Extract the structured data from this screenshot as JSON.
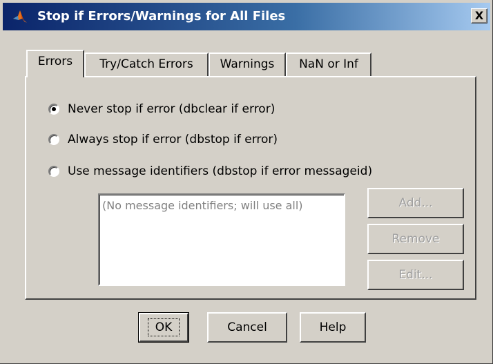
{
  "window": {
    "title": "Stop if Errors/Warnings for All Files",
    "close_label": "X"
  },
  "tabs": [
    {
      "label": "Errors",
      "active": true
    },
    {
      "label": "Try/Catch Errors",
      "active": false
    },
    {
      "label": "Warnings",
      "active": false
    },
    {
      "label": "NaN or Inf",
      "active": false
    }
  ],
  "errors_panel": {
    "options": [
      {
        "label": "Never stop if error (dbclear if error)",
        "selected": true
      },
      {
        "label": "Always stop if error (dbstop if error)",
        "selected": false
      },
      {
        "label": "Use message identifiers (dbstop if error messageid)",
        "selected": false
      }
    ],
    "identifiers_list": {
      "placeholder": "(No message identifiers; will use all)",
      "items": []
    },
    "buttons": {
      "add_label": "Add...",
      "remove_label": "Remove",
      "edit_label": "Edit..."
    }
  },
  "footer": {
    "ok_label": "OK",
    "cancel_label": "Cancel",
    "help_label": "Help"
  },
  "icons": {
    "app": "matlab-logo-icon",
    "close": "close-icon"
  },
  "colors": {
    "dialog_face": "#d4d0c8",
    "titlebar_start": "#0a246a",
    "titlebar_end": "#a6caf0",
    "disabled_text": "#a0a0a0"
  }
}
